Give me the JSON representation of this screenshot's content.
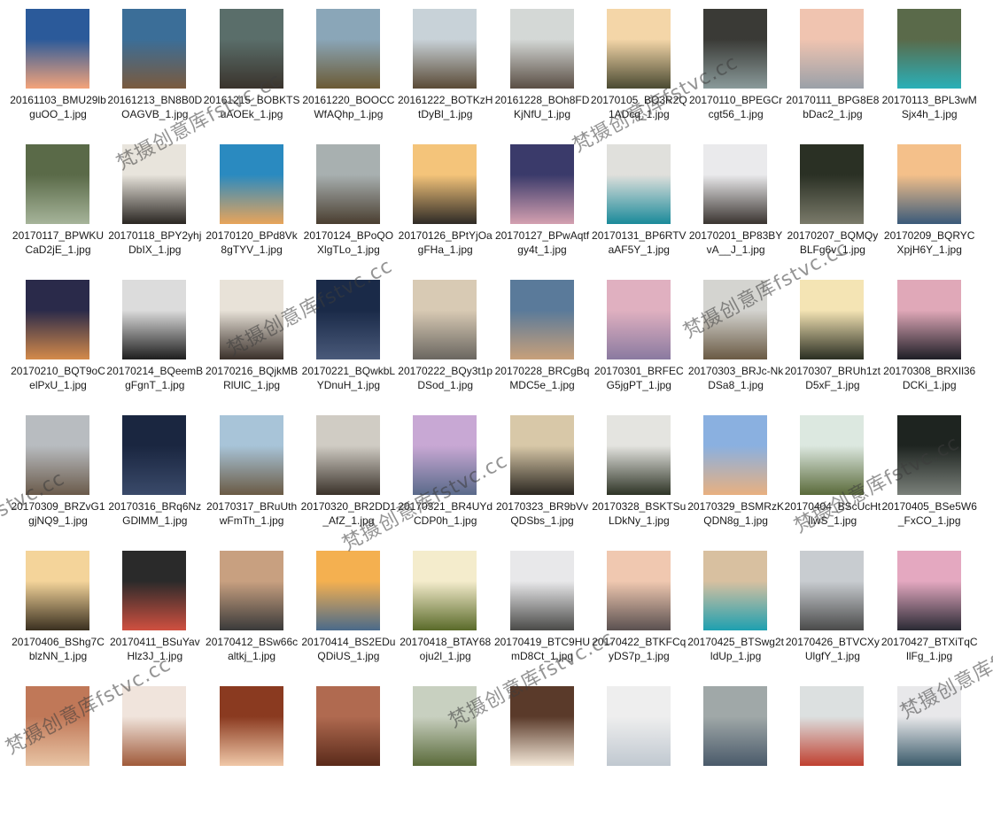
{
  "watermark": "梵摄创意库fstvc.cc",
  "files": [
    {
      "name": "20161103_BMU29lbguOO_1.jpg",
      "c1": "#2b5a9a",
      "c2": "#f4a37a"
    },
    {
      "name": "20161213_BN8B0DOAGVB_1.jpg",
      "c1": "#3b6e98",
      "c2": "#7a5a3e"
    },
    {
      "name": "20161215_BOBKTSuAOEk_1.jpg",
      "c1": "#5a6e6a",
      "c2": "#3a332c"
    },
    {
      "name": "20161220_BOOCCWfAQhp_1.jpg",
      "c1": "#8aa6b8",
      "c2": "#6b5a34"
    },
    {
      "name": "20161222_BOTKzHtDyBl_1.jpg",
      "c1": "#c8d2d8",
      "c2": "#5a4a36"
    },
    {
      "name": "20161228_BOh8FDKjNfU_1.jpg",
      "c1": "#d4d8d6",
      "c2": "#5a4e44"
    },
    {
      "name": "20170105_BO3R2Q1ADcq_1.jpg",
      "c1": "#f4d6a8",
      "c2": "#4a4a32"
    },
    {
      "name": "20170110_BPEGCrcgt56_1.jpg",
      "c1": "#3a3a36",
      "c2": "#8a9a9a"
    },
    {
      "name": "20170111_BPG8E8bDac2_1.jpg",
      "c1": "#f0c4b0",
      "c2": "#9aa0a8"
    },
    {
      "name": "20170113_BPL3wMSjx4h_1.jpg",
      "c1": "#5a6a4a",
      "c2": "#2ab0b8"
    },
    {
      "name": "20170117_BPWKUCaD2jE_1.jpg",
      "c1": "#5a6a48",
      "c2": "#a6b49a"
    },
    {
      "name": "20170118_BPY2yhjDbIX_1.jpg",
      "c1": "#e8e4dc",
      "c2": "#2a2622"
    },
    {
      "name": "20170120_BPd8Vk8gTYV_1.jpg",
      "c1": "#2a8ac0",
      "c2": "#e8a45a"
    },
    {
      "name": "20170124_BPoQOXlgTLo_1.jpg",
      "c1": "#a8b0b0",
      "c2": "#4a3e30"
    },
    {
      "name": "20170126_BPtYjOagFHa_1.jpg",
      "c1": "#f4c47a",
      "c2": "#2e2a26"
    },
    {
      "name": "20170127_BPwAqtfgy4t_1.jpg",
      "c1": "#3a3a6a",
      "c2": "#d4a0b0"
    },
    {
      "name": "20170131_BP6RTVaAF5Y_1.jpg",
      "c1": "#e0e0dc",
      "c2": "#1a8a9a"
    },
    {
      "name": "20170201_BP83BYvA__J_1.jpg",
      "c1": "#eaeaec",
      "c2": "#3a3430"
    },
    {
      "name": "20170207_BQMQyBLFg6v_1.jpg",
      "c1": "#2a3024",
      "c2": "#7a7a6a"
    },
    {
      "name": "20170209_BQRYCXpjH6Y_1.jpg",
      "c1": "#f4c08a",
      "c2": "#3a5a7a"
    },
    {
      "name": "20170210_BQT9oCelPxU_1.jpg",
      "c1": "#2a2a4a",
      "c2": "#d48a4a"
    },
    {
      "name": "20170214_BQeemBgFgnT_1.jpg",
      "c1": "#dcdcdc",
      "c2": "#1e1e1e"
    },
    {
      "name": "20170216_BQjkMBRlUlC_1.jpg",
      "c1": "#e8e2d8",
      "c2": "#3a302a"
    },
    {
      "name": "20170221_BQwkbLYDnuH_1.jpg",
      "c1": "#1a2a48",
      "c2": "#4a5a7a"
    },
    {
      "name": "20170222_BQy3t1pDSod_1.jpg",
      "c1": "#d8cab4",
      "c2": "#6a6660"
    },
    {
      "name": "20170228_BRCgBqMDC5e_1.jpg",
      "c1": "#5a7a9a",
      "c2": "#c8a07a"
    },
    {
      "name": "20170301_BRFECG5jgPT_1.jpg",
      "c1": "#e0b0c0",
      "c2": "#8a7aa0"
    },
    {
      "name": "20170303_BRJc-NkDSa8_1.jpg",
      "c1": "#d4d4d0",
      "c2": "#6a5a44"
    },
    {
      "name": "20170307_BRUh1ztD5xF_1.jpg",
      "c1": "#f4e4b4",
      "c2": "#2a2e22"
    },
    {
      "name": "20170308_BRXIl36DCKi_1.jpg",
      "c1": "#e0a8b8",
      "c2": "#1e1e26"
    },
    {
      "name": "20170309_BRZvG1gjNQ9_1.jpg",
      "c1": "#b8bcc0",
      "c2": "#6a5a4a"
    },
    {
      "name": "20170316_BRq6NzGDlMM_1.jpg",
      "c1": "#1a2640",
      "c2": "#3a4a6a"
    },
    {
      "name": "20170317_BRuUthwFmTh_1.jpg",
      "c1": "#a8c4d8",
      "c2": "#6a5a44"
    },
    {
      "name": "20170320_BR2DD1_AfZ_1.jpg",
      "c1": "#d0ccc4",
      "c2": "#3a322a"
    },
    {
      "name": "20170321_BR4UYdCDP0h_1.jpg",
      "c1": "#c8a8d4",
      "c2": "#5a6a8a"
    },
    {
      "name": "20170323_BR9bVvQDSbs_1.jpg",
      "c1": "#d8c8a8",
      "c2": "#2a2620"
    },
    {
      "name": "20170328_BSKTSuLDkNy_1.jpg",
      "c1": "#e4e4e0",
      "c2": "#2e3426"
    },
    {
      "name": "20170329_BSMRzKQDN8g_1.jpg",
      "c1": "#8ab0e0",
      "c2": "#e8b080"
    },
    {
      "name": "20170404_BScUcHtllwS_1.jpg",
      "c1": "#dce8e0",
      "c2": "#5a6a3a"
    },
    {
      "name": "20170405_BSe5W6_FxCO_1.jpg",
      "c1": "#1e2420",
      "c2": "#7a807a"
    },
    {
      "name": "20170406_BShg7CblzNN_1.jpg",
      "c1": "#f4d49a",
      "c2": "#3a3020"
    },
    {
      "name": "20170411_BSuYavHlz3J_1.jpg",
      "c1": "#2a2a2a",
      "c2": "#d05040"
    },
    {
      "name": "20170412_BSw66caltkj_1.jpg",
      "c1": "#c8a080",
      "c2": "#3a3a3a"
    },
    {
      "name": "20170414_BS2EDuQDiUS_1.jpg",
      "c1": "#f4b050",
      "c2": "#4a6a8a"
    },
    {
      "name": "20170418_BTAY68oju2l_1.jpg",
      "c1": "#f4eccc",
      "c2": "#5a6a2a"
    },
    {
      "name": "20170419_BTC9HUmD8Ct_1.jpg",
      "c1": "#e8e8ea",
      "c2": "#4a4a48"
    },
    {
      "name": "20170422_BTKFCqyDS7p_1.jpg",
      "c1": "#f0c8b0",
      "c2": "#5a5050"
    },
    {
      "name": "20170425_BTSwg2tldUp_1.jpg",
      "c1": "#d8c0a0",
      "c2": "#1ea0b0"
    },
    {
      "name": "20170426_BTVCXyUlgfY_1.jpg",
      "c1": "#c8ccd0",
      "c2": "#4a4a4a"
    },
    {
      "name": "20170427_BTXiTqCllFg_1.jpg",
      "c1": "#e4a8c0",
      "c2": "#2a2a34"
    },
    {
      "name": "",
      "c1": "#c07858",
      "c2": "#e8c4a4"
    },
    {
      "name": "",
      "c1": "#f0e4dc",
      "c2": "#a05a3a"
    },
    {
      "name": "",
      "c1": "#8a3a20",
      "c2": "#f0c8a8"
    },
    {
      "name": "",
      "c1": "#b06a50",
      "c2": "#5a2a1a"
    },
    {
      "name": "",
      "c1": "#c8d0c0",
      "c2": "#5a6a3a"
    },
    {
      "name": "",
      "c1": "#5a3a2a",
      "c2": "#f4e8d8"
    },
    {
      "name": "",
      "c1": "#eeeeee",
      "c2": "#c0c8d0"
    },
    {
      "name": "",
      "c1": "#a0a8a8",
      "c2": "#4a5a6a"
    },
    {
      "name": "",
      "c1": "#dce0e0",
      "c2": "#c04030"
    },
    {
      "name": "",
      "c1": "#e8e8ea",
      "c2": "#3a5a6a"
    }
  ]
}
